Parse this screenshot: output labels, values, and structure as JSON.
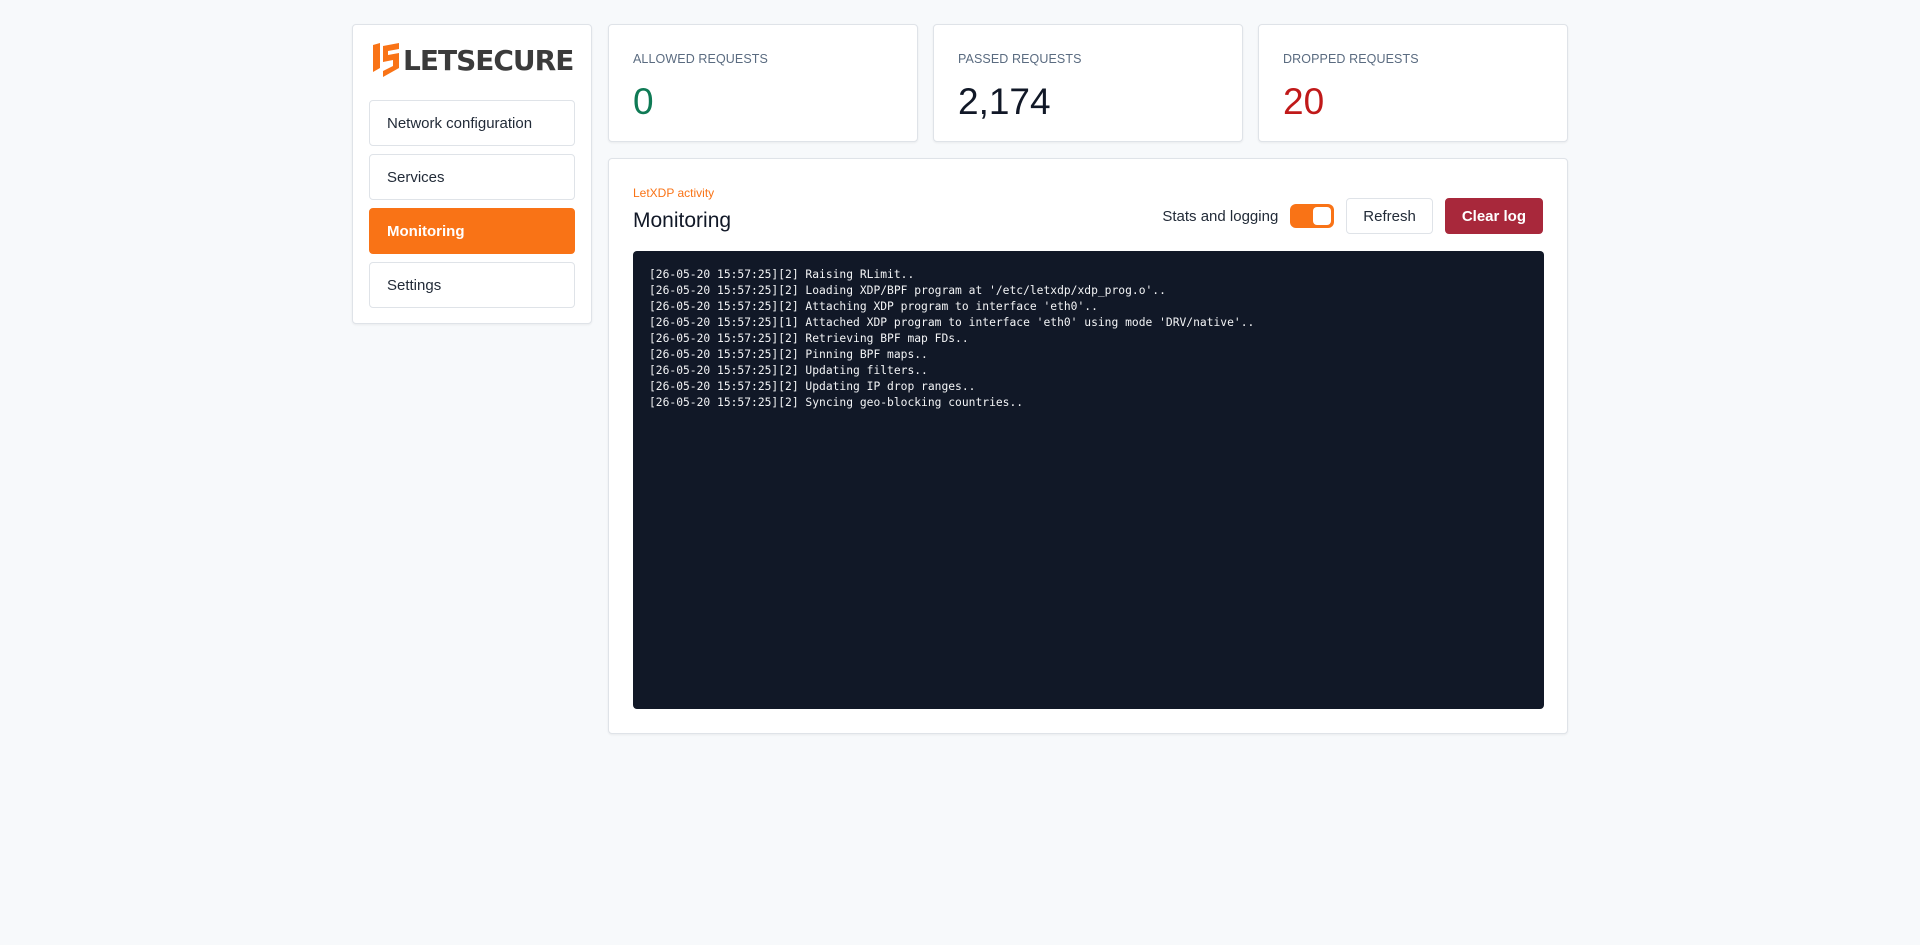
{
  "brand": {
    "name": "LETSECURE",
    "accent": "#f97316"
  },
  "sidebar": {
    "items": [
      {
        "label": "Network configuration",
        "active": false
      },
      {
        "label": "Services",
        "active": false
      },
      {
        "label": "Monitoring",
        "active": true
      },
      {
        "label": "Settings",
        "active": false
      }
    ]
  },
  "stats": {
    "allowed": {
      "label": "ALLOWED REQUESTS",
      "value": "0",
      "color": "#0f7a55"
    },
    "passed": {
      "label": "PASSED REQUESTS",
      "value": "2,174",
      "color": "#111827"
    },
    "dropped": {
      "label": "DROPPED REQUESTS",
      "value": "20",
      "color": "#c01919"
    }
  },
  "main": {
    "eyebrow": "LetXDP activity",
    "title": "Monitoring",
    "toggle_label": "Stats and logging",
    "toggle_on": true,
    "refresh_label": "Refresh",
    "clear_label": "Clear log",
    "log": [
      "[26-05-20 15:57:25][2] Raising RLimit..",
      "[26-05-20 15:57:25][2] Loading XDP/BPF program at '/etc/letxdp/xdp_prog.o'..",
      "[26-05-20 15:57:25][2] Attaching XDP program to interface 'eth0'..",
      "[26-05-20 15:57:25][1] Attached XDP program to interface 'eth0' using mode 'DRV/native'..",
      "[26-05-20 15:57:25][2] Retrieving BPF map FDs..",
      "[26-05-20 15:57:25][2] Pinning BPF maps..",
      "[26-05-20 15:57:25][2] Updating filters..",
      "[26-05-20 15:57:25][2] Updating IP drop ranges..",
      "[26-05-20 15:57:25][2] Syncing geo-blocking countries.."
    ]
  }
}
